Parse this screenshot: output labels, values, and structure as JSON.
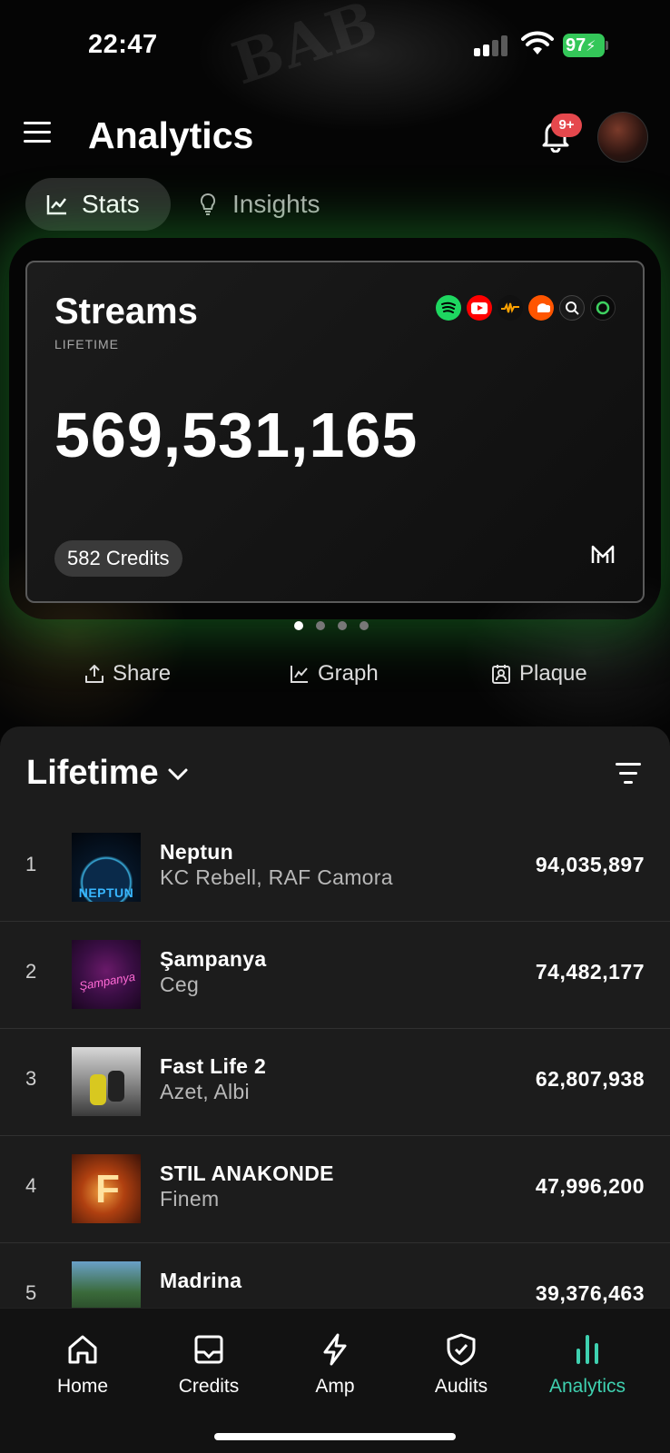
{
  "status_bar": {
    "time": "22:47",
    "battery": "97"
  },
  "header": {
    "title": "Analytics",
    "notification_badge": "9+"
  },
  "tabs": [
    {
      "label": "Stats",
      "icon": "chart-line-icon",
      "active": true
    },
    {
      "label": "Insights",
      "icon": "lightbulb-icon",
      "active": false
    }
  ],
  "card": {
    "title": "Streams",
    "subtitle": "LIFETIME",
    "value": "569,531,165",
    "credits": "582 Credits",
    "platforms": [
      "spotify-icon",
      "youtube-icon",
      "audiomack-icon",
      "soundcloud-icon",
      "shazam-icon",
      "apple-music-icon"
    ]
  },
  "pager": {
    "count": 4,
    "active": 0
  },
  "actions": {
    "share": "Share",
    "graph": "Graph",
    "plaque": "Plaque"
  },
  "list": {
    "period": "Lifetime",
    "rows": [
      {
        "rank": "1",
        "title": "Neptun",
        "artist": "KC Rebell, RAF Camora",
        "streams": "94,035,897",
        "cover_text": "NEPTUN"
      },
      {
        "rank": "2",
        "title": "Şampanya",
        "artist": "Ceg",
        "streams": "74,482,177",
        "cover_text": "Şampanya"
      },
      {
        "rank": "3",
        "title": "Fast Life 2",
        "artist": "Azet, Albi",
        "streams": "62,807,938",
        "cover_text": ""
      },
      {
        "rank": "4",
        "title": "STIL ANAKONDE",
        "artist": "Finem",
        "streams": "47,996,200",
        "cover_text": "F"
      },
      {
        "rank": "5",
        "title": "Madrina",
        "artist": "",
        "streams": "39,376,463",
        "cover_text": ""
      }
    ]
  },
  "tabbar": {
    "home": "Home",
    "credits": "Credits",
    "amp": "Amp",
    "audits": "Audits",
    "analytics": "Analytics"
  },
  "colors": {
    "accent": "#3fd1b0",
    "glow": "#28c83c",
    "badge": "#e5484d",
    "battery": "#34c759"
  }
}
